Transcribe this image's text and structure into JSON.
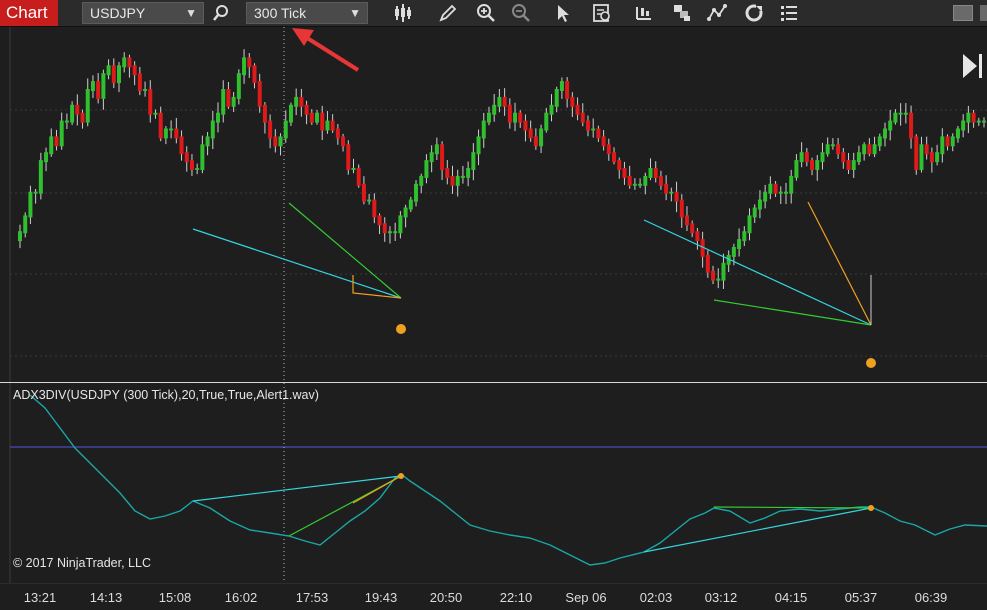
{
  "toolbar": {
    "tab_label": "Chart",
    "instrument": "USDJPY",
    "interval": "300 Tick",
    "icons": [
      "search-icon",
      "bar-type-icon",
      "draw-pencil-icon",
      "zoom-in-icon",
      "zoom-out-icon",
      "pointer-icon",
      "data-box-icon",
      "strategies-icon",
      "templates-icon",
      "indicators-icon",
      "refresh-icon",
      "properties-icon"
    ]
  },
  "indicator": {
    "title": "ADX3DIV(USDJPY (300 Tick),20,True,True,Alert1.wav)"
  },
  "copyright": "© 2017 NinjaTrader, LLC",
  "time_axis": [
    "13:21",
    "14:13",
    "15:08",
    "16:02",
    "17:53",
    "19:43",
    "20:50",
    "22:10",
    "Sep 06",
    "02:03",
    "03:12",
    "04:15",
    "05:37",
    "06:39"
  ],
  "colors": {
    "up_candle": "#2fbf2f",
    "down_candle": "#e01a1a",
    "cyan_line": "#33d6e0",
    "green_line": "#33cc33",
    "orange_line": "#f0a020",
    "dot": "#f0a020",
    "adx_line": "#1aa7a7",
    "level_line": "#5555dd",
    "annotation_arrow": "#e83535"
  },
  "chart_data": {
    "type": "candlestick",
    "title": "",
    "xlabel": "",
    "ylabel": "",
    "series": [
      {
        "values": [
          12,
          14,
          17,
          17,
          21,
          22,
          24,
          23,
          26,
          26,
          28,
          27,
          26,
          30,
          31,
          29,
          32,
          33,
          31,
          33,
          34,
          33,
          32,
          30,
          30,
          27,
          27,
          24,
          25,
          25,
          24,
          22,
          21,
          20,
          20,
          23,
          24,
          26,
          27,
          30,
          28,
          29,
          32,
          34,
          33,
          31,
          28,
          26,
          24,
          23,
          24,
          26,
          28,
          29,
          28,
          27,
          26,
          27,
          25,
          26,
          25,
          24,
          23,
          20,
          20,
          18,
          16,
          16,
          14,
          13,
          12,
          12,
          12,
          14,
          15,
          16,
          18,
          19,
          21,
          22,
          23,
          20,
          19,
          18,
          19,
          19,
          20,
          22,
          24,
          26,
          27,
          28,
          29,
          28,
          26,
          27,
          26,
          25,
          24,
          23,
          25,
          27,
          28,
          30,
          31,
          29,
          28,
          27,
          26,
          25,
          25,
          24,
          23,
          22,
          21,
          20,
          19,
          18,
          18,
          18,
          19,
          20,
          19,
          18,
          17,
          17,
          16,
          14,
          13,
          12,
          11,
          9,
          7,
          6,
          6,
          8,
          9,
          10,
          11,
          12,
          14,
          15,
          16,
          17,
          18,
          17,
          17,
          17,
          19,
          21,
          22,
          21,
          20,
          21,
          22,
          23,
          23,
          22,
          21,
          20,
          21,
          22,
          23,
          22,
          23,
          24,
          25,
          26,
          27,
          27,
          27,
          24,
          20,
          23,
          22,
          21,
          22,
          24,
          23,
          24,
          25,
          26,
          27,
          26,
          26,
          26
        ]
      }
    ]
  }
}
